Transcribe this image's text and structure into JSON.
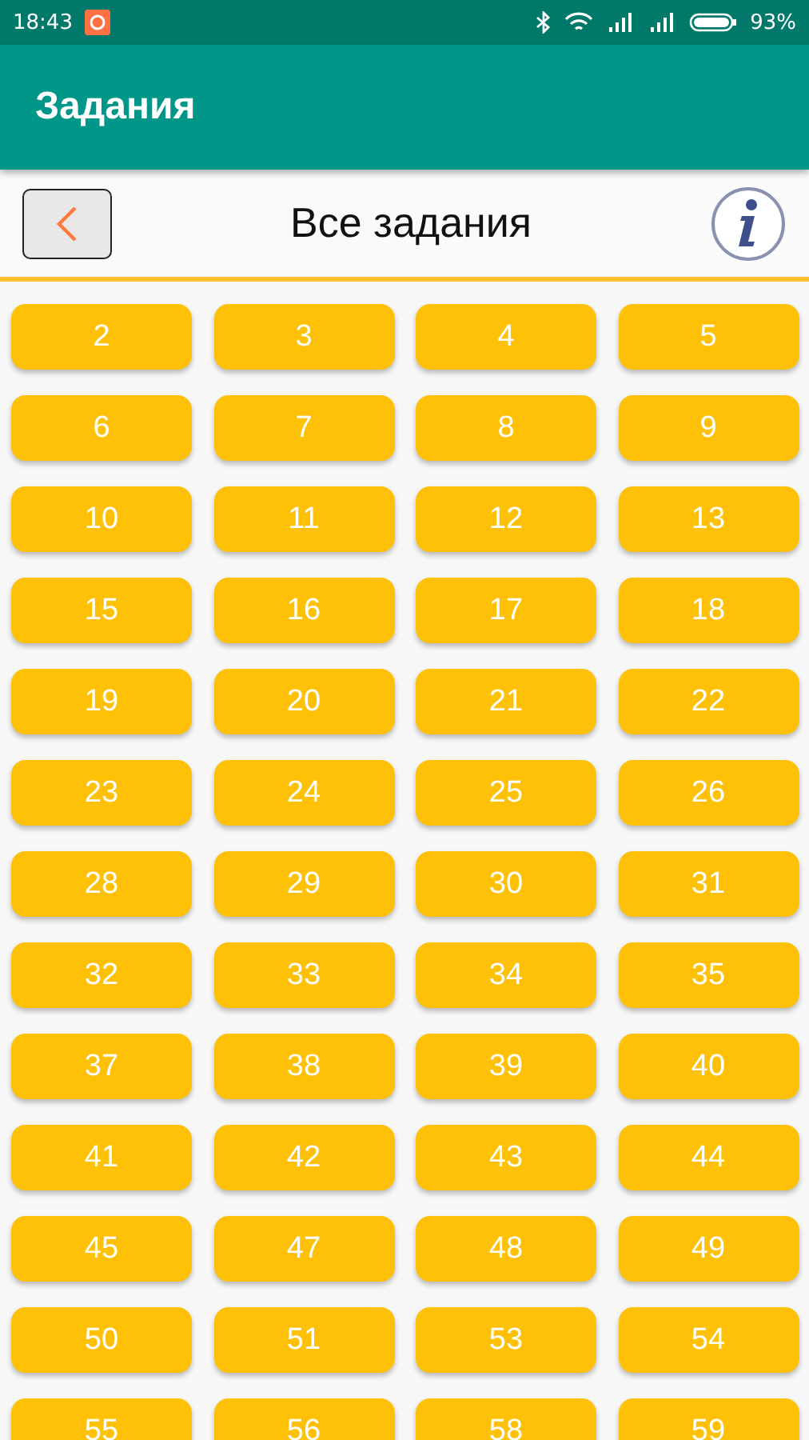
{
  "status_bar": {
    "time": "18:43",
    "battery": "93%"
  },
  "app_bar": {
    "title": "Задания"
  },
  "header": {
    "title": "Все задания"
  },
  "tasks": [
    "2",
    "3",
    "4",
    "5",
    "6",
    "7",
    "8",
    "9",
    "10",
    "11",
    "12",
    "13",
    "15",
    "16",
    "17",
    "18",
    "19",
    "20",
    "21",
    "22",
    "23",
    "24",
    "25",
    "26",
    "28",
    "29",
    "30",
    "31",
    "32",
    "33",
    "34",
    "35",
    "37",
    "38",
    "39",
    "40",
    "41",
    "42",
    "43",
    "44",
    "45",
    "47",
    "48",
    "49",
    "50",
    "51",
    "53",
    "54",
    "55",
    "56",
    "58",
    "59"
  ]
}
